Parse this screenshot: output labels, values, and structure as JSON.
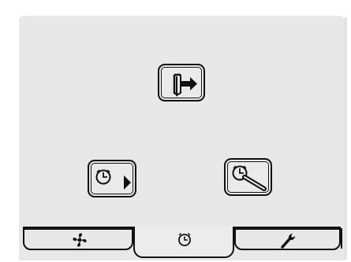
{
  "screen": {
    "background": "#e8e8e8",
    "outline": "#111111"
  },
  "buttons": {
    "exit": {
      "icon": "exit-arrow-icon"
    },
    "timer_run": {
      "icon": "clock-play-icon"
    },
    "timer_set": {
      "icon": "clock-wrench-icon"
    }
  },
  "tabs": [
    {
      "icon": "fan-icon",
      "selected": false
    },
    {
      "icon": "clock-icon",
      "selected": true
    },
    {
      "icon": "wrench-icon",
      "selected": false
    }
  ]
}
